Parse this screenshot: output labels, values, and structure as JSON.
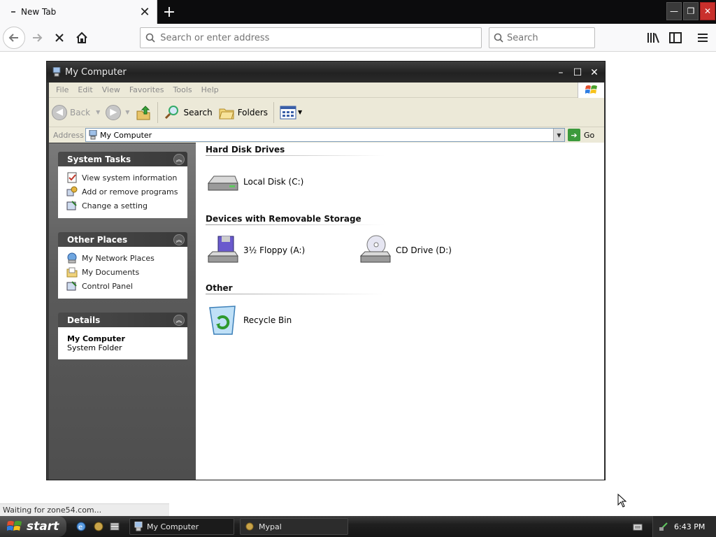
{
  "browser": {
    "tab_title": "New Tab",
    "url_placeholder": "Search or enter address",
    "search_placeholder": "Search",
    "status_text": "Waiting for zone54.com..."
  },
  "window": {
    "title": "My Computer",
    "menu": [
      "File",
      "Edit",
      "View",
      "Favorites",
      "Tools",
      "Help"
    ],
    "toolbar": {
      "back_label": "Back",
      "search_label": "Search",
      "folders_label": "Folders"
    },
    "address": {
      "label": "Address",
      "value": "My Computer",
      "go_label": "Go"
    }
  },
  "taskpane": {
    "system_tasks": {
      "title": "System Tasks",
      "items": [
        "View system information",
        "Add or remove programs",
        "Change a setting"
      ]
    },
    "other_places": {
      "title": "Other Places",
      "items": [
        "My Network Places",
        "My Documents",
        "Control Panel"
      ]
    },
    "details": {
      "title": "Details",
      "name": "My Computer",
      "type": "System Folder"
    }
  },
  "content": {
    "groups": [
      {
        "title": "Hard Disk Drives",
        "items": [
          "Local Disk (C:)"
        ]
      },
      {
        "title": "Devices with Removable Storage",
        "items": [
          "3½ Floppy (A:)",
          "CD Drive (D:)"
        ]
      },
      {
        "title": "Other",
        "items": [
          "Recycle Bin"
        ]
      }
    ]
  },
  "taskbar": {
    "start_label": "start",
    "buttons": [
      "My Computer",
      "Mypal"
    ],
    "clock": "6:43 PM"
  },
  "colors": {
    "xp_menu": "#ece9d8",
    "taskpane": "#5b5b5b",
    "titlebar": "#222222",
    "go_green": "#3c9a3c"
  }
}
